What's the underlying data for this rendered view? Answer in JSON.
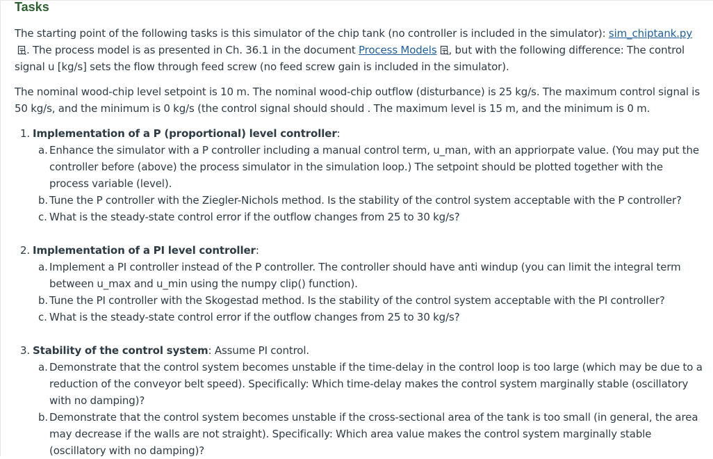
{
  "title": "Tasks",
  "intro": {
    "p1_a": "The starting point of the following tasks is this simulator of the chip tank (no controller is included in the simulator): ",
    "link_sim": "sim_chiptank.py",
    "p1_b": ". The process model is as presented in Ch. 36.1 in the document ",
    "link_models": "Process Models",
    "p1_c": ", but with the following difference: The control signal u [kg/s] sets the flow through feed screw (no feed screw gain is included in the simulator).",
    "p2": "The nominal wood-chip level setpoint is 10 m. The nominal wood-chip outflow (disturbance) is 25 kg/s. The maximum control signal is 50 kg/s, and the minimum is 0 kg/s (the control signal should should . The maximum level is 15 m, and the minimum is 0 m."
  },
  "tasks": [
    {
      "num": "1.",
      "heading": "Implementation of a P (proportional) level controller",
      "suffix": ":",
      "items": [
        {
          "letter": "a.",
          "text": "Enhance the simulator with a P controller including a manual control term, u_man, with an appriorpate value. (You may put the controller before (above) the process simulator in the simulation loop.) The setpoint should be plotted together with the process variable (level)."
        },
        {
          "letter": "b.",
          "text": "Tune the P controller with the Ziegler-Nichols method. Is the stability of the control system acceptable with the P controller?"
        },
        {
          "letter": "c.",
          "text": "What is the steady-state control error if the outflow changes from 25 to 30 kg/s?"
        }
      ]
    },
    {
      "num": "2.",
      "heading": "Implementation of a PI level controller",
      "suffix": ":",
      "items": [
        {
          "letter": "a.",
          "text": "Implement a PI controller instead of the P controller. The controller should have anti windup (you can limit the integral term between u_max and u_min using the numpy clip() function)."
        },
        {
          "letter": "b.",
          "text": "Tune the PI controller with the Skogestad method. Is the stability of the control system acceptable with the PI controller?"
        },
        {
          "letter": "c.",
          "text": "What is the steady-state control error if the outflow changes from 25 to 30 kg/s?"
        }
      ]
    },
    {
      "num": "3.",
      "heading": "Stability of the control system",
      "suffix": ": Assume PI control.",
      "items": [
        {
          "letter": "a.",
          "text": "Demonstrate that the control system becomes unstable if the time-delay in the control loop is too large (which may be due to a reduction of the conveyor belt speed). Specifically: Which time-delay makes the control system marginally stable (oscillatory with no damping)?"
        },
        {
          "letter": "b.",
          "text": "Demonstrate that the control system becomes unstable if the cross-sectional area of the tank is too small (in general, the area may decrease if the walls are not straight). Specifically: Which area value makes the control system marginally stable (oscillatory with no damping)?"
        }
      ]
    }
  ],
  "icons": {
    "file": "document-preview-icon"
  },
  "colors": {
    "title": "#2c5f2d",
    "link": "#1f5f9e",
    "text": "#2d3b45"
  }
}
